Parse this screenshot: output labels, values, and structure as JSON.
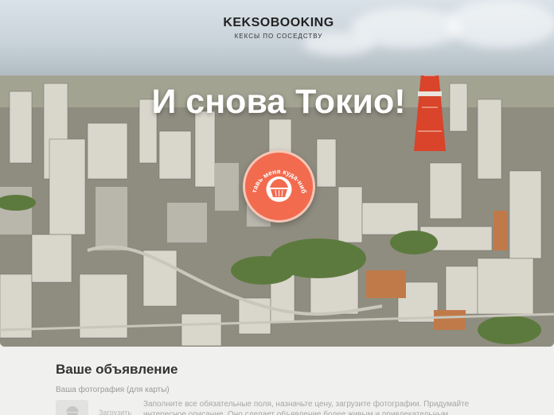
{
  "header": {
    "logo_title": "KEKSOBOOKING",
    "logo_subtitle": "КЕКСЫ ПО СОСЕДСТВУ"
  },
  "hero": {
    "headline": "И снова Токио!",
    "pin_text": "Поставь меня куда-нибудь"
  },
  "form": {
    "title": "Ваше объявление",
    "photo_label": "Ваша фотография (для карты)",
    "upload_label": "Загрузить",
    "hint": "Заполните все обязательные поля, назначьте цену, загрузите фотографии. Придумайте интересное описание. Оно сделает объявление более живым и привлекательным. Получившееся объявление"
  },
  "colors": {
    "pin": "#f26b4f",
    "text_dark": "#333333",
    "text_muted": "#a6a6a6"
  }
}
